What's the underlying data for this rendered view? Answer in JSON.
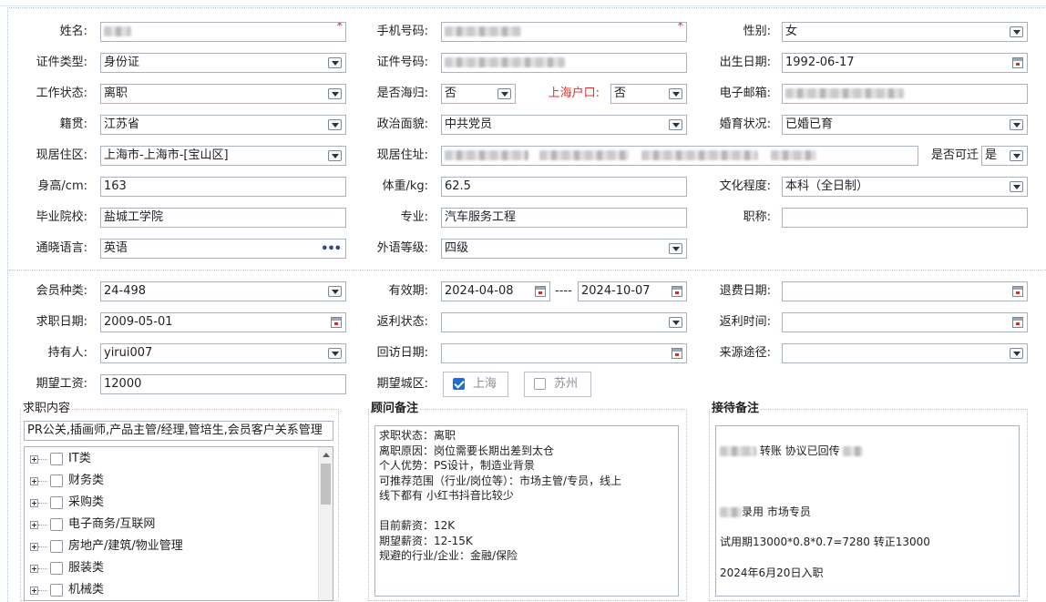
{
  "personal": {
    "name_label": "姓名:",
    "phone_label": "手机号码:",
    "gender_label": "性别:",
    "gender_value": "女",
    "id_type_label": "证件类型:",
    "id_type_value": "身份证",
    "id_no_label": "证件号码:",
    "birth_label": "出生日期:",
    "birth_value": "1992-06-17",
    "work_status_label": "工作状态:",
    "work_status_value": "离职",
    "returnee_label": "是否海归:",
    "returnee_value": "否",
    "sh_hukou_label": "上海户口:",
    "sh_hukou_value": "否",
    "email_label": "电子邮箱:",
    "native_label": "籍贯:",
    "native_value": "江苏省",
    "politics_label": "政治面貌:",
    "politics_value": "中共党员",
    "marital_label": "婚育状况:",
    "marital_value": "已婚已育",
    "residence_area_label": "现居住区:",
    "residence_area_value": "上海市-上海市-[宝山区]",
    "address_label": "现居住址:",
    "relocate_label": "是否可迁",
    "relocate_value": "是",
    "height_label": "身高/cm:",
    "height_value": "163",
    "weight_label": "体重/kg:",
    "weight_value": "62.5",
    "education_label": "文化程度:",
    "education_value": "本科（全日制）",
    "school_label": "毕业院校:",
    "school_value": "盐城工学院",
    "major_label": "专业:",
    "major_value": "汽车服务工程",
    "title_label": "职称:",
    "title_value": "",
    "language_label": "通晓语言:",
    "language_value": "英语",
    "lang_level_label": "外语等级:",
    "lang_level_value": "四级"
  },
  "membership": {
    "member_type_label": "会员种类:",
    "member_type_value": "24-498",
    "valid_label": "有效期:",
    "valid_from": "2024-04-08",
    "valid_sep": "----",
    "valid_to": "2024-10-07",
    "refund_date_label": "退费日期:",
    "refund_date_value": "",
    "job_date_label": "求职日期:",
    "job_date_value": "2009-05-01",
    "rebate_status_label": "返利状态:",
    "rebate_status_value": "",
    "rebate_time_label": "返利时间:",
    "rebate_time_value": "",
    "holder_label": "持有人:",
    "holder_value": "yirui007",
    "visit_date_label": "回访日期:",
    "visit_date_value": "",
    "source_label": "来源途径:",
    "source_value": "",
    "salary_label": "期望工资:",
    "salary_value": "12000",
    "city_label": "期望城区:",
    "cities": [
      {
        "name": "上海",
        "checked": true
      },
      {
        "name": "苏州",
        "checked": false
      }
    ]
  },
  "job_content": {
    "title": "求职内容",
    "summary": "PR公关,插画师,产品主管/经理,管培生,会员客户关系管理",
    "categories": [
      "IT类",
      "财务类",
      "采购类",
      "电子商务/互联网",
      "房地产/建筑/物业管理",
      "服装类",
      "机械类"
    ]
  },
  "advisor_notes": {
    "title": "顾问备注",
    "text": "求职状态：离职\n离职原因：岗位需要长期出差到太仓\n个人优势：PS设计，制造业背景\n可推荐范围（行业/岗位等）：市场主管/专员，线上\n线下都有 小红书抖音比较少\n\n目前薪资：12K\n期望薪资：12-15K\n规避的行业/企业：金融/保险"
  },
  "reception_notes": {
    "title": "接待备注",
    "line1": "转账 协议已回传",
    "line2": "录用 市场专员",
    "line3": "试用期13000*0.8*0.7=7280 转正13000",
    "line4": "2024年6月20日入职"
  },
  "colors": {
    "accent_red": "#e03030",
    "checkbox_blue": "#1a6fd8",
    "border": "#a9b3be"
  }
}
